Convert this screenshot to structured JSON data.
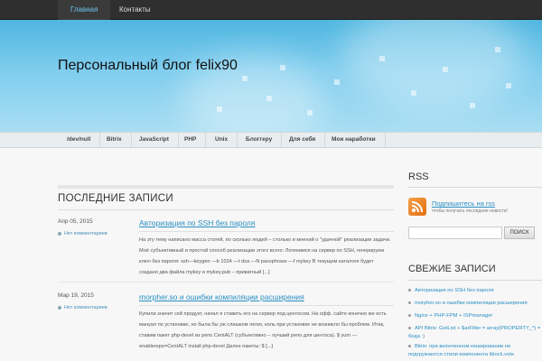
{
  "topbar": {
    "items": [
      {
        "label": "Главная"
      },
      {
        "label": "Контакты"
      }
    ]
  },
  "header": {
    "site_title": "Персональный блог felix90"
  },
  "nav": {
    "items": [
      {
        "label": "/dev/null"
      },
      {
        "label": "Bitrix"
      },
      {
        "label": "JavaScript"
      },
      {
        "label": "PHP"
      },
      {
        "label": "Unix"
      },
      {
        "label": "Блоггеру"
      },
      {
        "label": "Для себя"
      },
      {
        "label": "Мои наработки"
      }
    ]
  },
  "main": {
    "section_title": "ПОСЛЕДНИЕ ЗАПИСИ",
    "posts": [
      {
        "date": "Апр 05, 2015",
        "comments": "Нет комментариев",
        "title": "Авторизация по SSH без пароля",
        "excerpt": "На эту тему написано масса статей, по сколько людей – столько и мнений о \"удачной\" реализации задачи. Моё субъективный и простой способ реализации этого всего: Логинимся на сервер по SSH, генерируем ключ без пароля: ssh—keygen —b 1024 —t dsa —N passphrase —f mykey В текущем каталоге будет создано два файла mykey и mykey.pub – приватный [...]"
      },
      {
        "date": "Мар 19, 2015",
        "comments": "Нет комментариев",
        "title": "morpher.so и ошибки компиляции расширения",
        "excerpt": "Купили значит сей продукт, начал я ставить его на сервер под центосом. На офф. сайте конечно же есть мануал по установке, но была бы уж слишком легко, коль при установке не возникло бы проблем. Итак, ставим пакет php-devel из репо CentALT (субъективно – лучший репо для центоса). $ yum —enablerepo=CentALT install php-devel Далее пакеты: $ [...]"
      }
    ]
  },
  "sidebar": {
    "rss_title": "RSS",
    "rss_link": "Подпишитесь на rss",
    "rss_sub": "чтобы получать последние новости!",
    "search_placeholder": "",
    "search_button": "ПОИСК",
    "recent_title": "СВЕЖИЕ ЗАПИСИ",
    "recent_items": [
      {
        "label": "Авторизация по SSH без пароля"
      },
      {
        "label": "morpher.so и ошибки компиляции расширения"
      },
      {
        "label": "Nginx + PHP-FPM + ISPmanager"
      },
      {
        "label": "API Bitrix: GetList + $arFilter = array(PROPERTY_*) = беда :)"
      },
      {
        "label": "Bitrix: при включенном кешировании не подгружаются стили компонента iblock.vote"
      }
    ]
  },
  "colors": {
    "accent": "#2a8fc3",
    "header_sky": "#7fcdee",
    "topbar": "#2f2f2f"
  }
}
